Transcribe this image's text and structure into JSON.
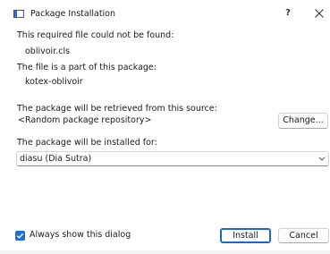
{
  "window": {
    "title": "Package Installation",
    "help_glyph": "?",
    "close_icon": "close-icon",
    "app_icon": "window-icon"
  },
  "messages": {
    "not_found_label": "This required file could not be found:",
    "file_name": "oblivoir.cls",
    "package_label": "The file is a part of this package:",
    "package_name": "kotex-oblivoir"
  },
  "source": {
    "label": "The package will be retrieved from this source:",
    "value": "<Random package repository>",
    "change_button": "Change..."
  },
  "install_for": {
    "label": "The package will be installed for:",
    "selected": "diasu (Dia Sutra)"
  },
  "footer": {
    "checkbox_label": "Always show this dialog",
    "checkbox_checked": true,
    "install_button": "Install",
    "cancel_button": "Cancel"
  },
  "colors": {
    "accent": "#1f6fd1"
  }
}
